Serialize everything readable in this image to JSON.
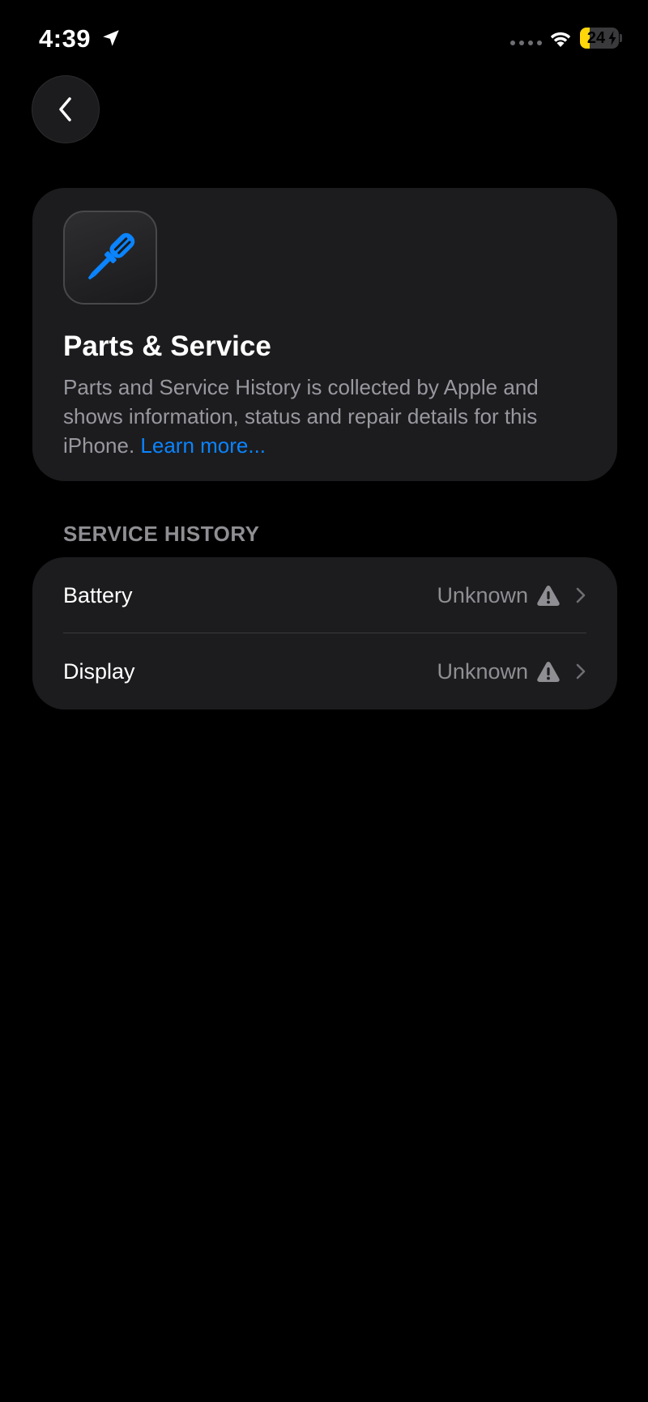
{
  "status_bar": {
    "time": "4:39",
    "battery_level": "24",
    "battery_fraction": 0.24,
    "icons": [
      "location-arrow-icon",
      "signal-dots-icon",
      "wifi-icon",
      "battery-charging-icon"
    ]
  },
  "nav": {
    "back_icon": "chevron-left-icon"
  },
  "header": {
    "icon": "screwdriver-icon",
    "title": "Parts & Service",
    "description": "Parts and Service History is collected by Apple and shows information, status and repair details for this iPhone. ",
    "link_label": "Learn more..."
  },
  "service_history": {
    "section_title": "SERVICE HISTORY",
    "rows": [
      {
        "label": "Battery",
        "value": "Unknown",
        "icon": "warning-icon"
      },
      {
        "label": "Display",
        "value": "Unknown",
        "icon": "warning-icon"
      }
    ]
  },
  "colors": {
    "background": "#000000",
    "card": "#1c1c1e",
    "accent": "#0a84ff",
    "secondary_text": "#8e8e93",
    "battery": "#ffd60a"
  }
}
